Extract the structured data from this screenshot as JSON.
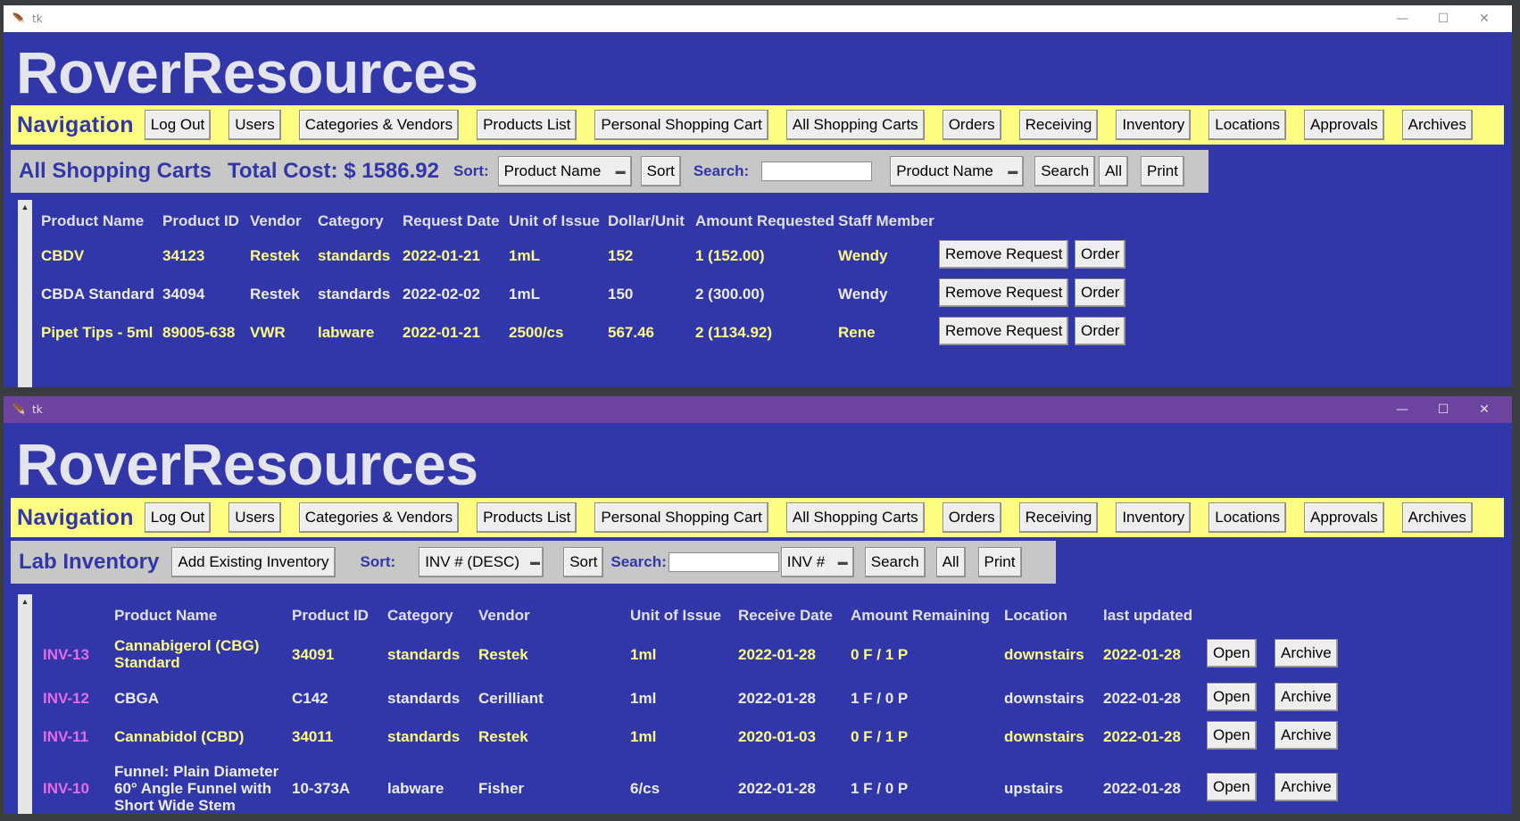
{
  "app": {
    "window_title": "tk",
    "brand": "RoverResources",
    "feather_icon": "feather-icon"
  },
  "nav": {
    "title": "Navigation",
    "buttons": [
      "Log Out",
      "Users",
      "Categories & Vendors",
      "Products List",
      "Personal Shopping Cart",
      "All Shopping Carts",
      "Orders",
      "Receiving",
      "Inventory",
      "Locations",
      "Approvals",
      "Archives"
    ]
  },
  "carts": {
    "title": "All Shopping Carts",
    "total": "Total Cost: $ 1586.92",
    "sort_label": "Sort:",
    "sort_value": "Product Name",
    "sort_button": "Sort",
    "search_label": "Search:",
    "search_value": "",
    "search_field": "Product Name",
    "search_button": "Search",
    "all_button": "All",
    "print_button": "Print",
    "headers": [
      "Product Name",
      "Product ID",
      "Vendor",
      "Category",
      "Request Date",
      "Unit of Issue",
      "Dollar/Unit",
      "Amount Requested",
      "Staff Member"
    ],
    "rows": [
      {
        "color": "yellow",
        "product": "CBDV",
        "id": "34123",
        "vendor": "Restek",
        "category": "standards",
        "date": "2022-01-21",
        "unit": "1mL",
        "dollar": "152",
        "amount": "1 (152.00)",
        "staff": "Wendy",
        "remove": "Remove Request",
        "order": "Order"
      },
      {
        "color": "white",
        "product": "CBDA Standard",
        "id": "34094",
        "vendor": "Restek",
        "category": "standards",
        "date": "2022-02-02",
        "unit": "1mL",
        "dollar": "150",
        "amount": "2 (300.00)",
        "staff": "Wendy",
        "remove": "Remove Request",
        "order": "Order"
      },
      {
        "color": "yellow",
        "product": "Pipet Tips - 5ml",
        "id": "89005-638",
        "vendor": "VWR",
        "category": "labware",
        "date": "2022-01-21",
        "unit": "2500/cs",
        "dollar": "567.46",
        "amount": "2 (1134.92)",
        "staff": "Rene",
        "remove": "Remove Request",
        "order": "Order"
      }
    ]
  },
  "inventory": {
    "title": "Lab Inventory",
    "add_button": "Add Existing Inventory",
    "sort_label": "Sort:",
    "sort_value": "INV # (DESC)",
    "sort_button": "Sort",
    "search_label": "Search:",
    "search_value": "",
    "search_field": "INV #",
    "search_button": "Search",
    "all_button": "All",
    "print_button": "Print",
    "headers": [
      "Product Name",
      "Product ID",
      "Category",
      "Vendor",
      "Unit of Issue",
      "Receive Date",
      "Amount Remaining",
      "Location",
      "last updated"
    ],
    "rows": [
      {
        "color": "yellow",
        "inv": "INV-13",
        "product": "Cannabigerol (CBG) Standard",
        "id": "34091",
        "category": "standards",
        "vendor": "Restek",
        "unit": "1ml",
        "date": "2022-01-28",
        "amount": "0 F / 1 P",
        "location": "downstairs",
        "updated": "2022-01-28",
        "open": "Open",
        "archive": "Archive"
      },
      {
        "color": "white",
        "inv": "INV-12",
        "product": "CBGA",
        "id": "C142",
        "category": "standards",
        "vendor": "Cerilliant",
        "unit": "1ml",
        "date": "2022-01-28",
        "amount": "1 F / 0 P",
        "location": "downstairs",
        "updated": "2022-01-28",
        "open": "Open",
        "archive": "Archive"
      },
      {
        "color": "yellow",
        "inv": "INV-11",
        "product": "Cannabidol (CBD)",
        "id": "34011",
        "category": "standards",
        "vendor": "Restek",
        "unit": "1ml",
        "date": "2020-01-03",
        "amount": "0 F / 1 P",
        "location": "downstairs",
        "updated": "2022-01-28",
        "open": "Open",
        "archive": "Archive"
      },
      {
        "color": "white",
        "inv": "INV-10",
        "product": "Funnel: Plain Diameter 60° Angle Funnel with Short Wide Stem",
        "id": "10-373A",
        "category": "labware",
        "vendor": "Fisher",
        "unit": "6/cs",
        "date": "2022-01-28",
        "amount": "1 F / 0 P",
        "location": "upstairs",
        "updated": "2022-01-28",
        "open": "Open",
        "archive": "Archive"
      }
    ]
  },
  "colors": {
    "background": "#3136a9",
    "nav": "#fcfc82",
    "highlight": "#fcfc82",
    "inv": "#e66be6"
  }
}
